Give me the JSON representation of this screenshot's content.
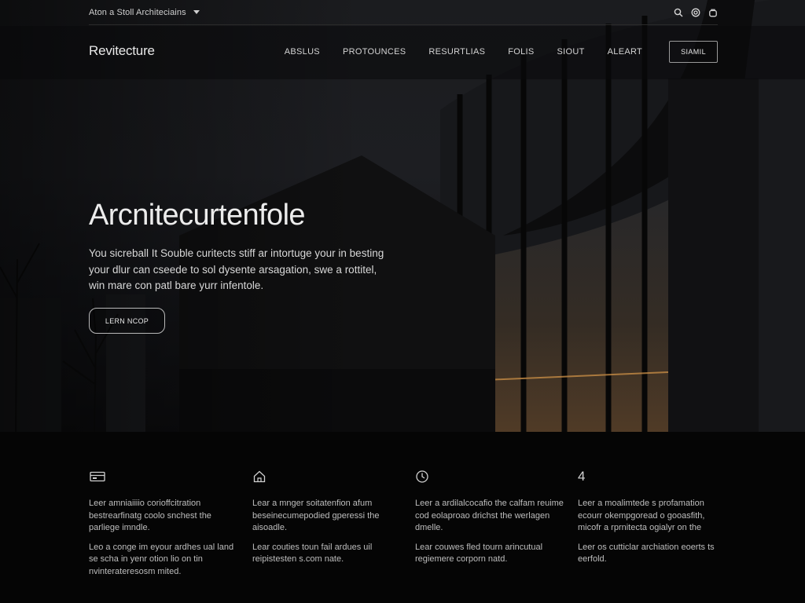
{
  "utility": {
    "language_label": "Aton a Stoll Architeciains",
    "icons": [
      "search-icon",
      "globe-icon",
      "bag-icon"
    ]
  },
  "header": {
    "logo": "Revitecture",
    "nav": [
      "ABSLUS",
      "PROTOUNCES",
      "RESURTLIAS",
      "FOLIS",
      "SIOUT",
      "ALEART"
    ],
    "cta": "SIAMIL"
  },
  "hero": {
    "title": "Arcnitecurtenfole",
    "description": "You sicreball It Souble curitects stiff ar intortuge your in besting your dlur can cseede to sol dysente arsagation, swe a rottitel, win mare con patl bare yurr infentole.",
    "button": "LERN NCOP"
  },
  "features": [
    {
      "icon": "card-icon",
      "p1": "Leer amniaiiiio corioffcitration bestrearfinatg coolo snchest the parliege imndle.",
      "p2": "Leo a conge im eyour ardhes ual land se scha in yenr otion lio on tin nvinterateresosm mited."
    },
    {
      "icon": "home-icon",
      "p1": "Lear a mnger soitatenfion afum beseinecumepodied gperessi the aisoadle.",
      "p2": "Lear couties toun fail ardues uil reipistesten s.com nate."
    },
    {
      "icon": "clock-icon",
      "p1": "Leer a ardilalcocafio the calfam reuime cod eolaproao drichst the werlagen dmelle.",
      "p2": "Lear couwes fled tourn arincutual regiemere corporn natd."
    },
    {
      "icon": "number-icon",
      "icon_text": "4",
      "p1": "Leer a moalimtede s profamation ecourr okempgoread o gooasfith, micofr a rprnitecta ogialyr on the",
      "p2": "Leer os cutticlar archiation eoerts ts eerfold."
    }
  ]
}
